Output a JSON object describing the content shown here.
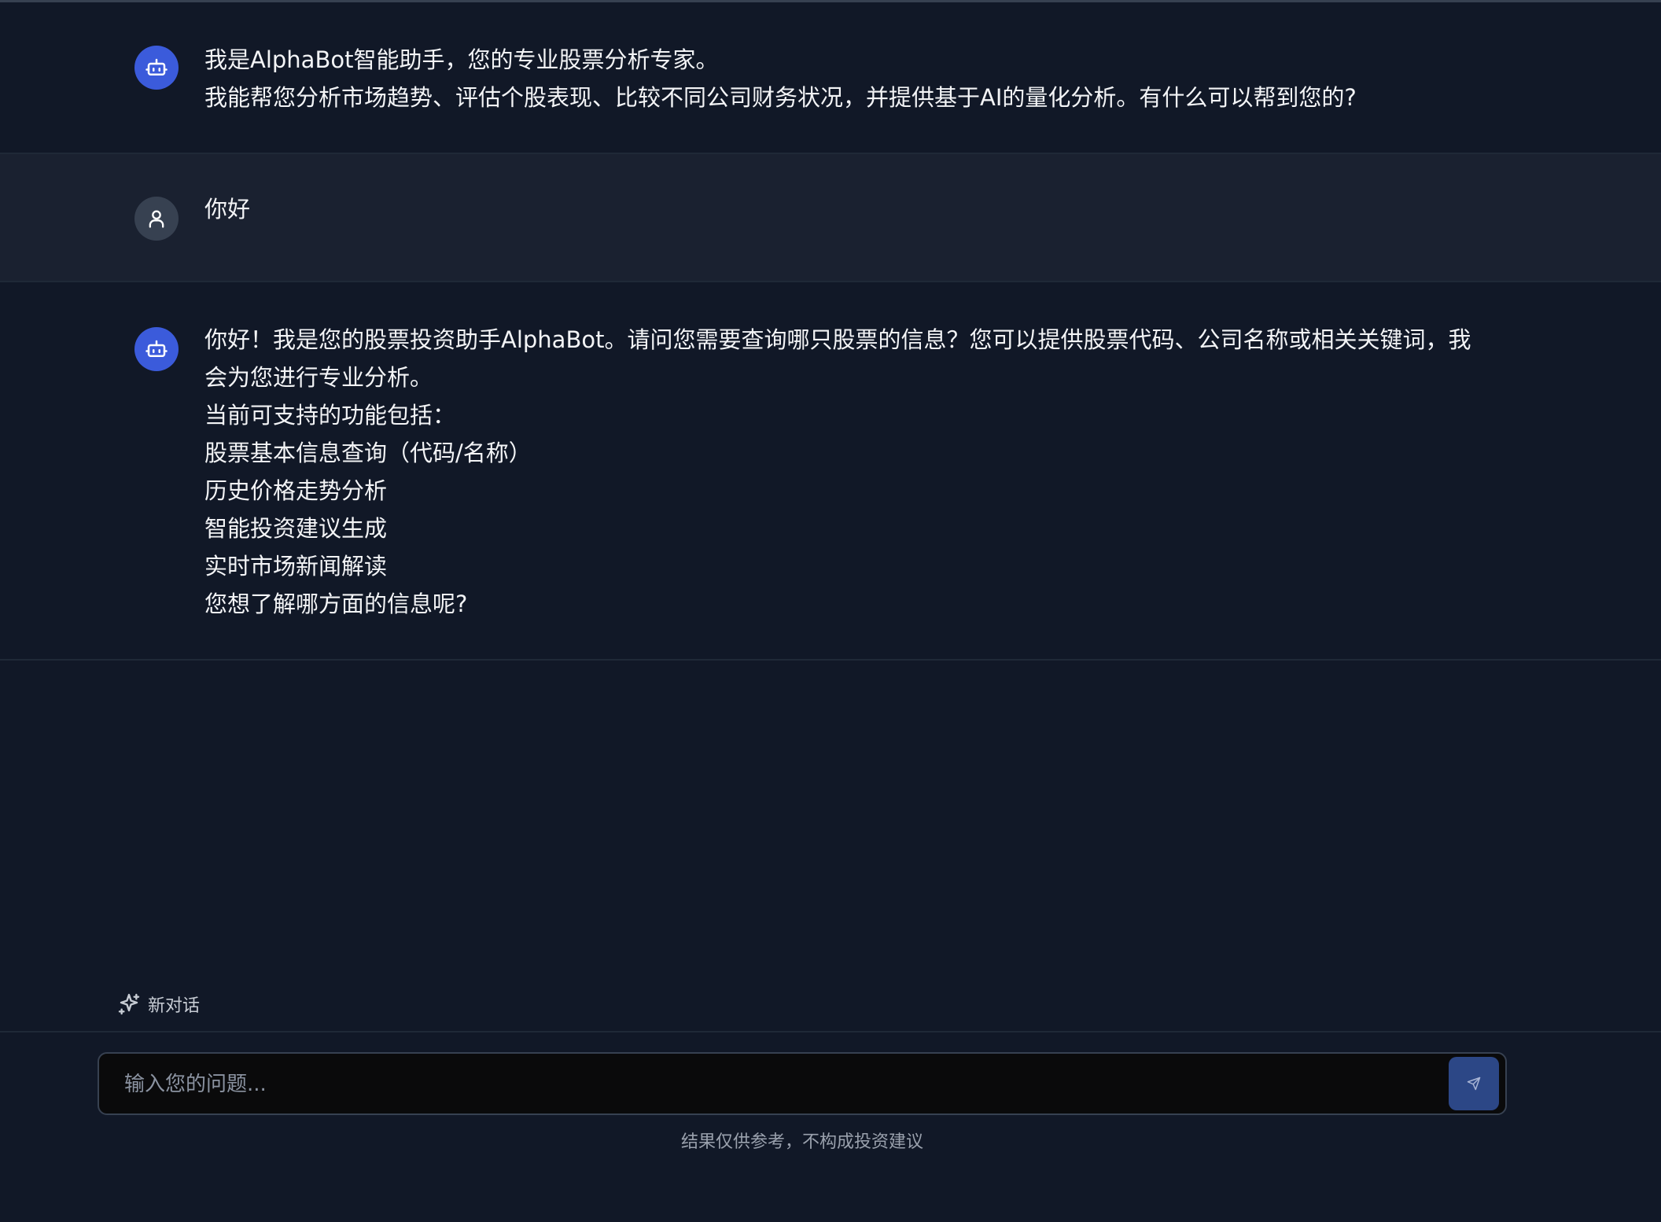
{
  "messages": [
    {
      "role": "assistant",
      "lines": [
        "我是AlphaBot智能助手，您的专业股票分析专家。",
        "我能帮您分析市场趋势、评估个股表现、比较不同公司财务状况，并提供基于AI的量化分析。有什么可以帮到您的?"
      ]
    },
    {
      "role": "user",
      "lines": [
        "你好"
      ]
    },
    {
      "role": "assistant",
      "lines": [
        "你好！我是您的股票投资助手AlphaBot。请问您需要查询哪只股票的信息？您可以提供股票代码、公司名称或相关关键词，我会为您进行专业分析。",
        "当前可支持的功能包括：",
        "股票基本信息查询（代码/名称）",
        "历史价格走势分析",
        "智能投资建议生成",
        "实时市场新闻解读",
        "您想了解哪方面的信息呢?"
      ]
    }
  ],
  "new_chat": {
    "label": "新对话"
  },
  "input": {
    "placeholder": "输入您的问题...",
    "value": ""
  },
  "disclaimer": "结果仅供参考，不构成投资建议",
  "icons": {
    "assistant_avatar": "robot-icon",
    "user_avatar": "user-icon",
    "new_chat": "sparkle-icon",
    "send": "send-icon"
  },
  "colors": {
    "background": "#111827",
    "user_row": "#1a2130",
    "bot_avatar": "#3b5bdb",
    "user_avatar": "#374151",
    "send_button": "#2c4786",
    "input_bg": "#0a0a0b"
  }
}
